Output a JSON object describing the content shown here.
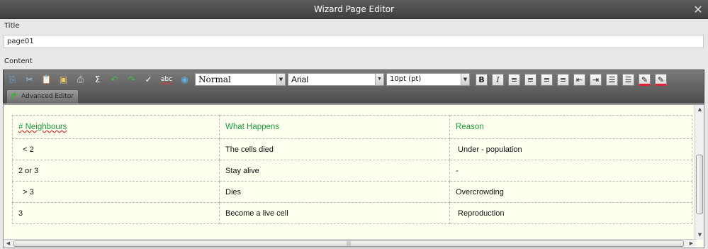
{
  "window": {
    "title": "Wizard Page Editor",
    "close_glyph": "✕"
  },
  "title_label": "Title",
  "title_value": "page01",
  "content_label": "Content",
  "toolbar": {
    "icons": [
      {
        "name": "copy-icon",
        "glyph": "⎘",
        "color": "#6fa8dc"
      },
      {
        "name": "cut-icon",
        "glyph": "✂",
        "color": "#9ec5e8"
      },
      {
        "name": "paste-icon",
        "glyph": "📋",
        "color": "#e0b060"
      },
      {
        "name": "image-icon",
        "glyph": "▣",
        "color": "#e3c36a"
      },
      {
        "name": "print-icon",
        "glyph": "⎙",
        "color": "#cfd8e0"
      },
      {
        "name": "sum-icon",
        "glyph": "Σ",
        "color": "#ffffff"
      },
      {
        "name": "undo-icon",
        "glyph": "↶",
        "color": "#46c046"
      },
      {
        "name": "redo-icon",
        "glyph": "↷",
        "color": "#46c046"
      },
      {
        "name": "spellcheck-icon",
        "glyph": "✓",
        "color": "#ffffff"
      },
      {
        "name": "abc-spell-icon",
        "glyph": "abc",
        "color": "#ffffff"
      },
      {
        "name": "globe-icon",
        "glyph": "◉",
        "color": "#5fb0e8"
      }
    ],
    "style_select": "Normal",
    "font_select": "Arial",
    "size_select": "10pt (pt)",
    "format_buttons": [
      {
        "name": "bold-button",
        "glyph": "B"
      },
      {
        "name": "italic-button",
        "glyph": "I"
      },
      {
        "name": "align-left-button",
        "glyph": "≡"
      },
      {
        "name": "align-center-button",
        "glyph": "≡"
      },
      {
        "name": "align-right-button",
        "glyph": "≡"
      },
      {
        "name": "justify-button",
        "glyph": "≡"
      },
      {
        "name": "outdent-button",
        "glyph": "⇤"
      },
      {
        "name": "indent-button",
        "glyph": "⇥"
      },
      {
        "name": "numbered-list-button",
        "glyph": "☰"
      },
      {
        "name": "bullet-list-button",
        "glyph": "☰"
      },
      {
        "name": "text-color-button",
        "glyph": "✎"
      },
      {
        "name": "highlight-button",
        "glyph": "✎"
      }
    ],
    "advanced_editor": "Advanced Editor"
  },
  "table": {
    "headers": [
      "# Neighbours",
      "What Happens",
      "Reason"
    ],
    "rows": [
      [
        "  < 2",
        "The cells died",
        " Under - population"
      ],
      [
        "2 or 3",
        "Stay alive",
        "-"
      ],
      [
        "  > 3",
        "Dies",
        "Overcrowding"
      ],
      [
        "3",
        "Become a live cell",
        " Reproduction"
      ]
    ]
  }
}
